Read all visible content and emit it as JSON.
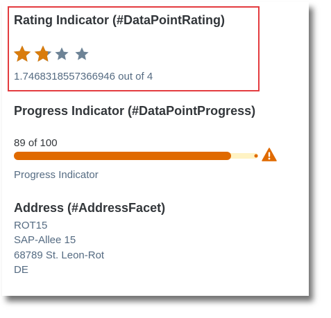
{
  "rating": {
    "title": "Rating Indicator (#DataPointRating)",
    "value": 1.7468318557366946,
    "max": 4,
    "caption": "1.7468318557366946 out of 4",
    "filled_color": "#d97c0d",
    "empty_color": "#6d8396"
  },
  "progress": {
    "title": "Progress Indicator (#DataPointProgress)",
    "value_text": "89 of 100",
    "value": 89,
    "max": 100,
    "fill_color": "#e06a00",
    "track_color": "#fff3c4",
    "warning_color": "#e06a00",
    "caption": "Progress Indicator"
  },
  "address": {
    "title": "Address (#AddressFacet)",
    "lines": [
      "ROT15",
      "SAP-Allee 15",
      "68789 St. Leon-Rot",
      "DE"
    ]
  },
  "highlight_color": "#e33b3f"
}
